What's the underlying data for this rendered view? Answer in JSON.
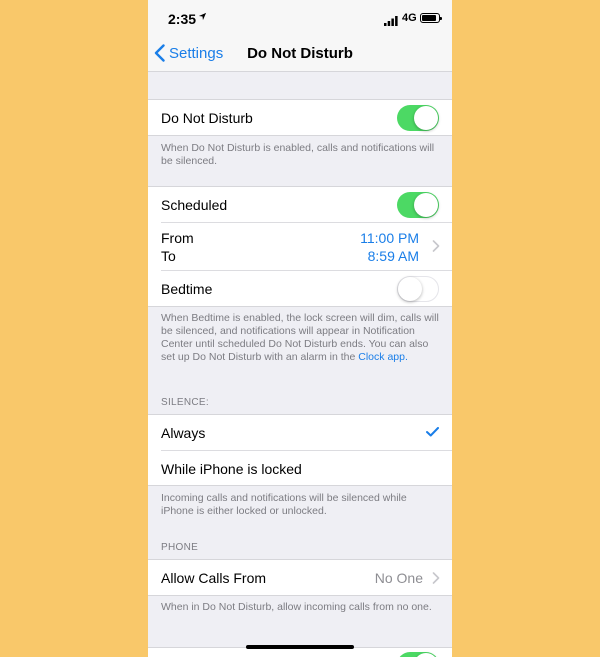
{
  "status_bar": {
    "time": "2:35",
    "network": "4G"
  },
  "nav": {
    "back_label": "Settings",
    "title": "Do Not Disturb"
  },
  "dnd": {
    "label": "Do Not Disturb",
    "on": true,
    "footer": "When Do Not Disturb is enabled, calls and notifications will be silenced."
  },
  "schedule": {
    "scheduled_label": "Scheduled",
    "scheduled_on": true,
    "from_label": "From",
    "to_label": "To",
    "from_time": "11:00 PM",
    "to_time": "8:59 AM",
    "bedtime_label": "Bedtime",
    "bedtime_on": false,
    "footer": "When Bedtime is enabled, the lock screen will dim, calls will be silenced, and notifications will appear in Notification Center until scheduled Do Not Disturb ends. You can also set up Do Not Disturb with an alarm in the",
    "footer_link": "Clock app."
  },
  "silence": {
    "header": "SILENCE:",
    "always_label": "Always",
    "always_checked": true,
    "locked_label": "While iPhone is locked",
    "footer": "Incoming calls and notifications will be silenced while iPhone is either locked or unlocked."
  },
  "phone": {
    "header": "PHONE",
    "allow_label": "Allow Calls From",
    "allow_value": "No One",
    "footer": "When in Do Not Disturb, allow incoming calls from no one."
  },
  "colors": {
    "accent": "#1a7ee8",
    "toggle_on": "#4cd964",
    "background": "#f9c86a"
  }
}
